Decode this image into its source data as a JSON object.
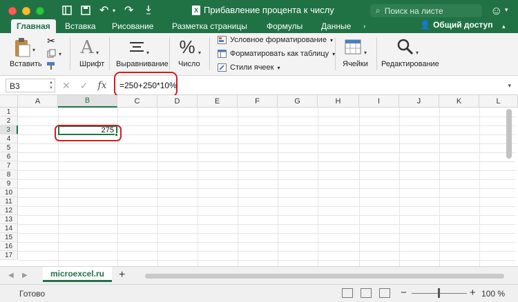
{
  "window": {
    "title": "Прибавление процента к числу",
    "search_placeholder": "Поиск на листе"
  },
  "tabs": [
    {
      "label": "Главная",
      "active": true
    },
    {
      "label": "Вставка"
    },
    {
      "label": "Рисование"
    },
    {
      "label": "Разметка страницы"
    },
    {
      "label": "Формулы"
    },
    {
      "label": "Данные"
    }
  ],
  "share_label": "Общий доступ",
  "ribbon": {
    "paste": "Вставить",
    "font": "Шрифт",
    "align": "Выравнивание",
    "number": "Число",
    "conditional": "Условное форматирование",
    "format_table": "Форматировать как таблицу",
    "cell_styles": "Стили ячеек",
    "cells": "Ячейки",
    "editing": "Редактирование"
  },
  "formula_bar": {
    "name_box": "B3",
    "fx": "fx",
    "formula": "=250+250*10%"
  },
  "grid": {
    "columns": [
      "A",
      "B",
      "C",
      "D",
      "E",
      "F",
      "G",
      "H",
      "I",
      "J",
      "K",
      "L"
    ],
    "rows": [
      "1",
      "2",
      "3",
      "4",
      "5",
      "6",
      "7",
      "8",
      "9",
      "10",
      "11",
      "12",
      "13",
      "14",
      "15",
      "16",
      "17"
    ],
    "selected_cell": "B3",
    "b3_value": "275"
  },
  "sheet": {
    "tab_label": "microexcel.ru",
    "add_label": "+"
  },
  "status": {
    "text": "Готово",
    "zoom_minus": "−",
    "zoom_plus": "+",
    "zoom": "100 %"
  },
  "colors": {
    "accent": "#207245",
    "highlight": "#d21c1c"
  }
}
